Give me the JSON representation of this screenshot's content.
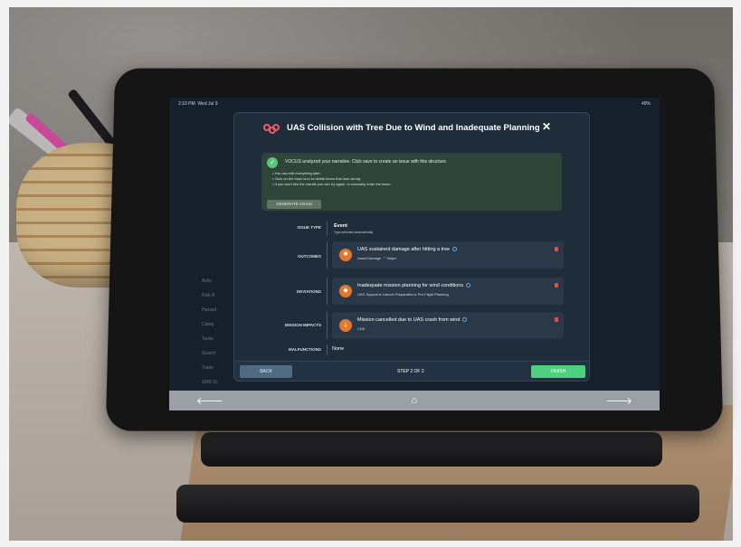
{
  "status_bar": {
    "time": "2:10 PM",
    "date": "Wed Jul 9",
    "battery": "49%"
  },
  "background_items": [
    "Actio",
    "Risk A",
    "Hazard",
    "Categ",
    "Tasks",
    "Search",
    "Trash",
    "SMS Sc"
  ],
  "modal": {
    "title": "UAS Collision with Tree Due to Wind and Inadequate Planning",
    "close": "✕",
    "notice": {
      "heading": "VOCUS analyzed your narrative. Click save to create an issue with this structure.",
      "bullets": [
        "You can edit everything later.",
        "Click on the trash icon to delete items that look wrong.",
        "If you don't like the results you can try again, or manually enter the issue."
      ],
      "generate_again": "GENERATE AGAIN"
    },
    "issue_type": {
      "label": "ISSUE TYPE",
      "value": "Event",
      "sub": "Type selected automatically."
    },
    "outcomes": {
      "label": "OUTCOMES",
      "title": "UAS sustained damage after hitting a tree",
      "category": "Asset Damage",
      "severity": "Major"
    },
    "deviations": {
      "label": "DEVIATIONS",
      "title": "Inadequate mission planning for wind conditions",
      "path": "UAS Support ▸ Launch Preparation ▸ Pre-Flight Planning"
    },
    "mission_impacts": {
      "label": "MISSION IMPACTS",
      "title": "Mission cancelled due to UAS crash from wind",
      "sub": "CNX"
    },
    "malfunctions": {
      "label": "MALFUNCTIONS",
      "value": "None"
    },
    "footer": {
      "back": "BACK",
      "step": "STEP 2 OF 2",
      "finish": "FINISH"
    }
  },
  "nav": {
    "back_arrow": "🡐",
    "home": "⌂",
    "forward_arrow": "🡒"
  },
  "colors": {
    "finish": "#4dd17f",
    "accent_orange": "#e0782d",
    "trash": "#ef4b4b",
    "notice_bg": "#2f4539"
  }
}
